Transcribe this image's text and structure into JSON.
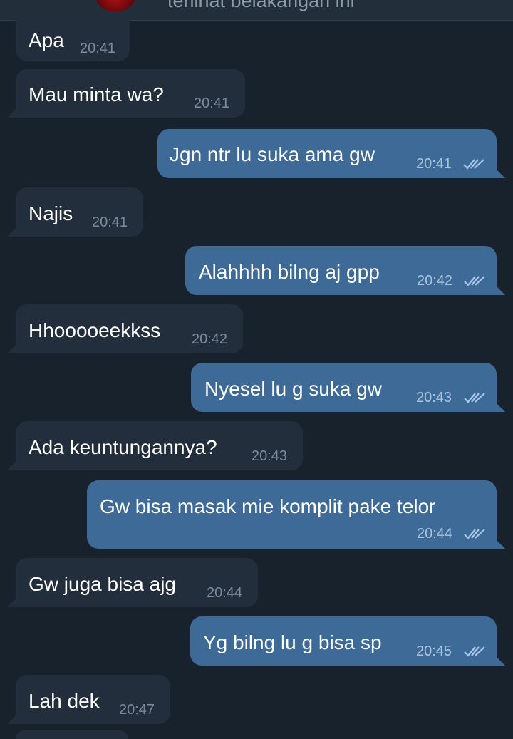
{
  "header": {
    "subtitle": "terlihat belakangan ini"
  },
  "messages": [
    {
      "dir": "in",
      "text": "Apa",
      "time": "20:41"
    },
    {
      "dir": "in",
      "text": "Mau minta wa?",
      "time": "20:41"
    },
    {
      "dir": "out",
      "text": "Jgn ntr lu suka ama gw",
      "time": "20:41",
      "status": "read"
    },
    {
      "dir": "in",
      "text": "Najis",
      "time": "20:41"
    },
    {
      "dir": "out",
      "text": "Alahhhh bilng aj gpp",
      "time": "20:42",
      "status": "read"
    },
    {
      "dir": "in",
      "text": "Hhooooeekkss",
      "time": "20:42"
    },
    {
      "dir": "out",
      "text": "Nyesel lu g suka gw",
      "time": "20:43",
      "status": "read"
    },
    {
      "dir": "in",
      "text": "Ada keuntungannya?",
      "time": "20:43"
    },
    {
      "dir": "out",
      "text": "Gw bisa masak mie komplit pake telor",
      "time": "20:44",
      "status": "read"
    },
    {
      "dir": "in",
      "text": "Gw juga bisa ajg",
      "time": "20:44"
    },
    {
      "dir": "out",
      "text": "Yg bilng lu g bisa sp",
      "time": "20:45",
      "status": "read"
    },
    {
      "dir": "in",
      "text": "Lah dek",
      "time": "20:47"
    }
  ],
  "colors": {
    "background": "#18222d",
    "incoming_bubble": "#232e3c",
    "outgoing_bubble": "#3d6a97",
    "read_ticks": "#a9c9ea"
  }
}
